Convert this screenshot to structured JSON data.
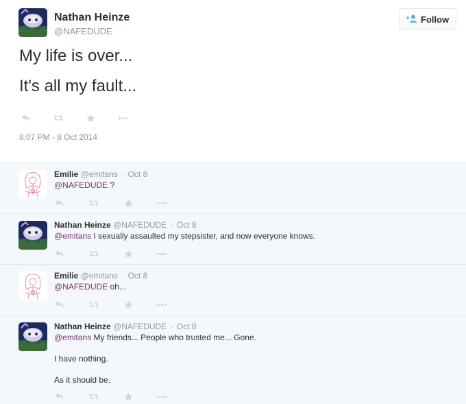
{
  "colors": {
    "mention": "#7a2e72",
    "muted": "#8899a6",
    "action_icon": "#ccd6dd",
    "follow_icon": "#55acee"
  },
  "main": {
    "name": "Nathan Heinze",
    "handle": "@NAFEDUDE",
    "follow_label": "Follow",
    "text_line1": "My life is over...",
    "text_line2": "It's all my fault...",
    "timestamp": "8:07 PM - 8 Oct 2014",
    "icons": [
      "reply-icon",
      "retweet-icon",
      "favorite-icon",
      "more-icon"
    ]
  },
  "replies": [
    {
      "name": "Emilie",
      "handle": "@emitans",
      "sep": "·",
      "date": "Oct 8",
      "mention": "@NAFEDUDE",
      "text": " ?"
    },
    {
      "name": "Nathan Heinze",
      "handle": "@NAFEDUDE",
      "sep": "·",
      "date": "Oct 8",
      "mention": "@emitans",
      "text": " I sexually assaulted my stepsister, and now everyone knows."
    },
    {
      "name": "Emilie",
      "handle": "@emitans",
      "sep": "·",
      "date": "Oct 8",
      "mention": "@NAFEDUDE",
      "text": " oh..."
    },
    {
      "name": "Nathan Heinze",
      "handle": "@NAFEDUDE",
      "sep": "·",
      "date": "Oct 8",
      "mention": "@emitans",
      "text": " My friends... People who trusted me... Gone.",
      "para2": "I have nothing.",
      "para3": "As it should be."
    }
  ]
}
